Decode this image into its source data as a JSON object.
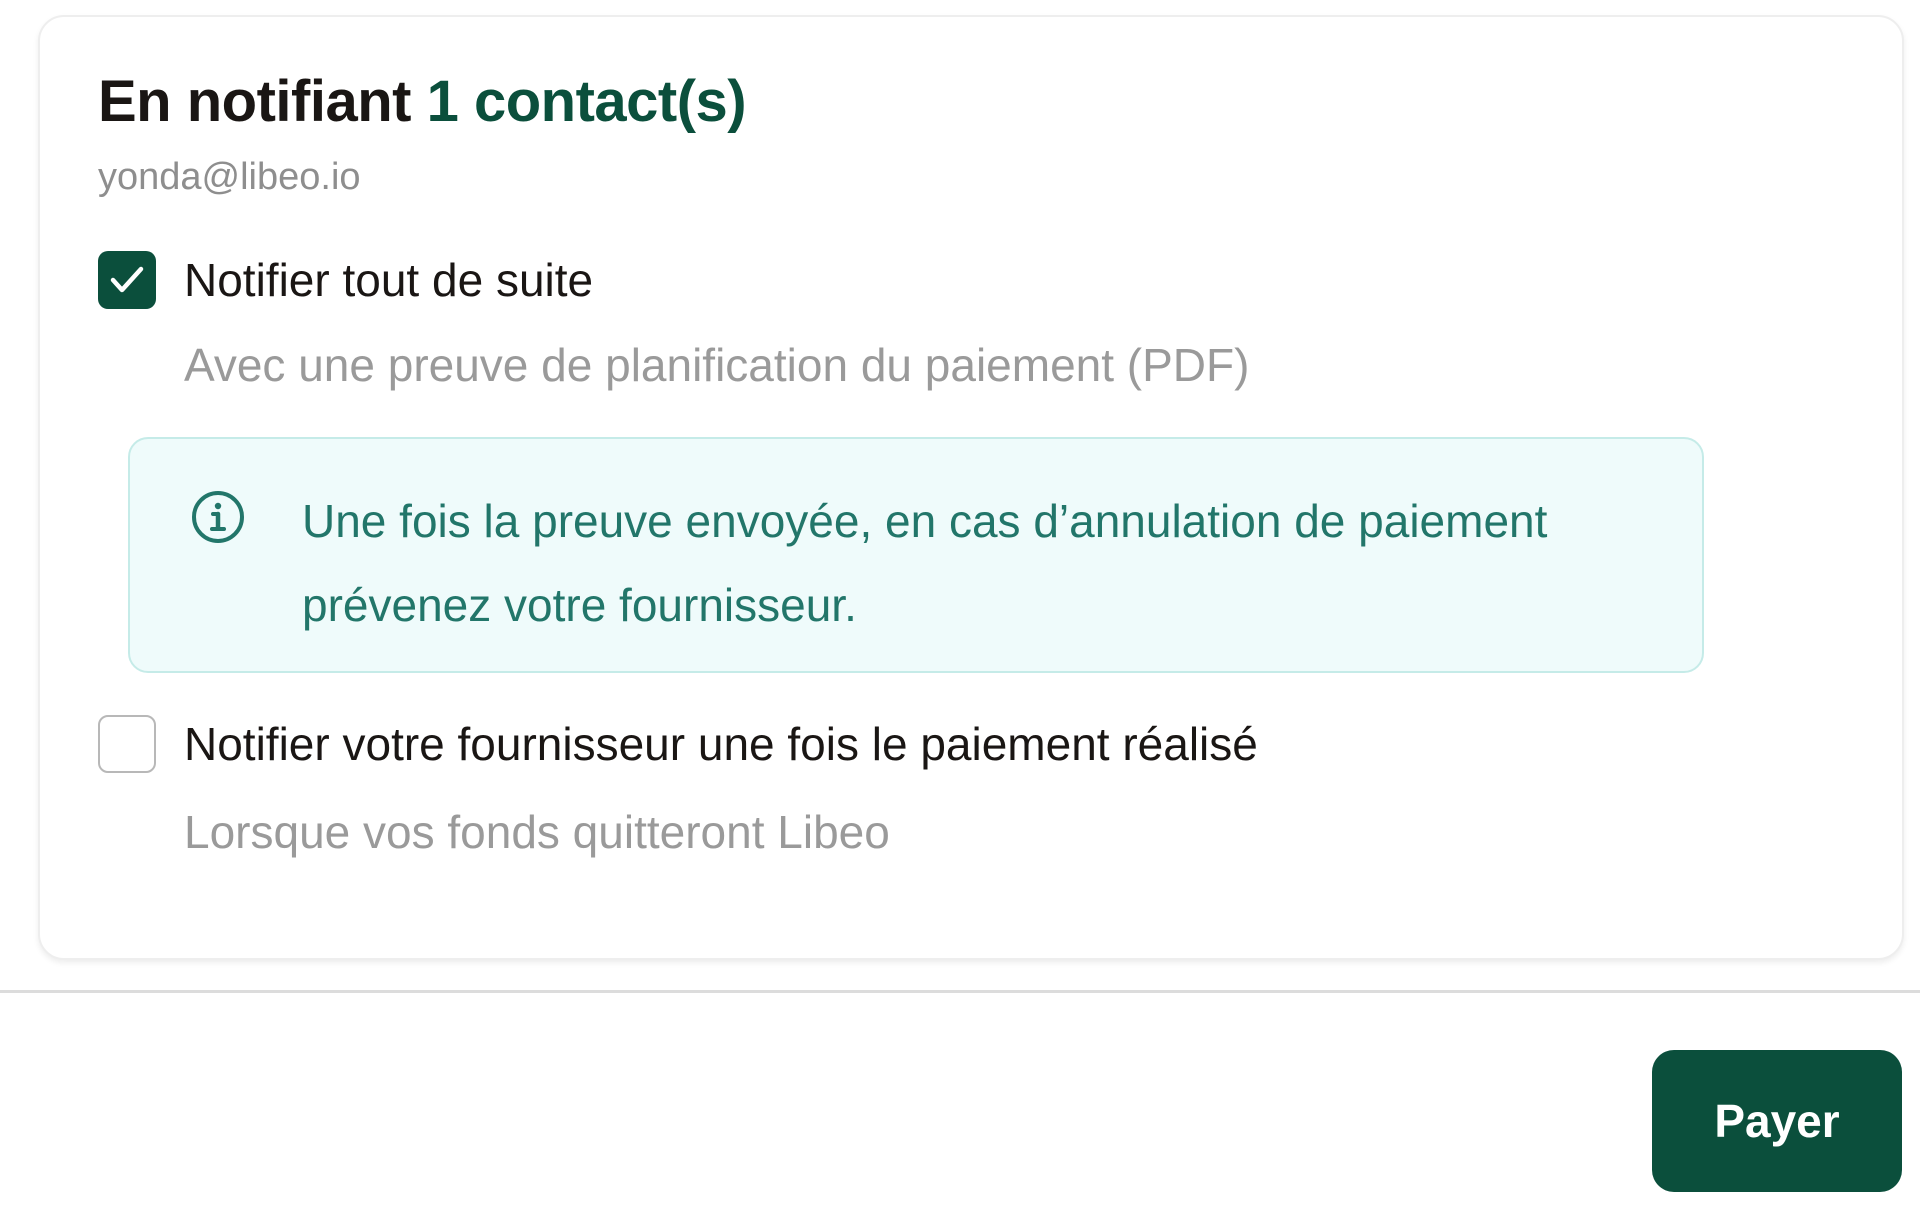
{
  "notification_card": {
    "title_prefix": "En notifiant",
    "title_count": "1 contact(s)",
    "contact_email": "yonda@libeo.io",
    "options": [
      {
        "label": "Notifier tout de suite",
        "description": "Avec une preuve de planification du paiement (PDF)",
        "checked": true
      },
      {
        "label": "Notifier votre fournisseur une fois le paiement réalisé",
        "description": "Lorsque vos fonds quitteront Libeo",
        "checked": false
      }
    ],
    "info_box": {
      "icon": "info-circle-icon",
      "text": "Une fois la preuve envoyée, en cas d’annulation de paiement prévenez votre fournisseur."
    }
  },
  "footer": {
    "pay_button_label": "Payer"
  },
  "colors": {
    "brand_green": "#0b4f3c",
    "info_background": "#effbfb",
    "info_text": "#22766a",
    "muted_text": "#9a9a9a"
  }
}
